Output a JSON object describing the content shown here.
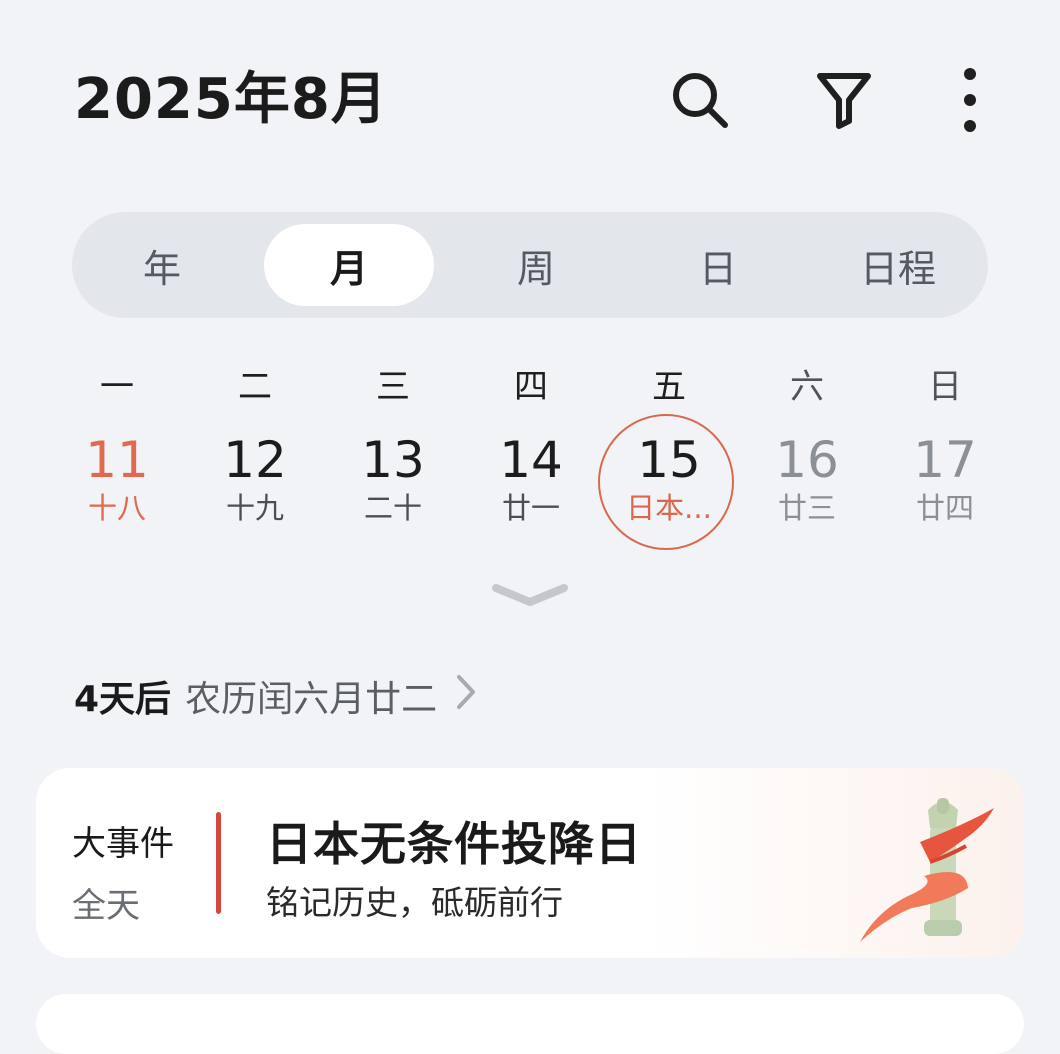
{
  "header": {
    "title": "2025年8月",
    "icons": [
      "search-icon",
      "filter-icon",
      "more-icon"
    ]
  },
  "view_tabs": {
    "items": [
      "年",
      "月",
      "周",
      "日",
      "日程"
    ],
    "selected": "月"
  },
  "weekdays": [
    "一",
    "二",
    "三",
    "四",
    "五",
    "六",
    "日"
  ],
  "days": [
    {
      "num": "11",
      "lunar": "十八"
    },
    {
      "num": "12",
      "lunar": "十九"
    },
    {
      "num": "13",
      "lunar": "二十"
    },
    {
      "num": "14",
      "lunar": "廿一"
    },
    {
      "num": "15",
      "lunar": "日本..."
    },
    {
      "num": "16",
      "lunar": "廿三"
    },
    {
      "num": "17",
      "lunar": "廿四"
    }
  ],
  "countdown": {
    "days_text": "4天后",
    "lunar_text": "农历闰六月廿二"
  },
  "event": {
    "type": "大事件",
    "time": "全天",
    "title": "日本无条件投降日",
    "subtitle": "铭记历史，砥砺前行"
  },
  "colors": {
    "background": "#f1f3f6",
    "accent": "#d9694e",
    "event_bar": "#d24a3f"
  }
}
